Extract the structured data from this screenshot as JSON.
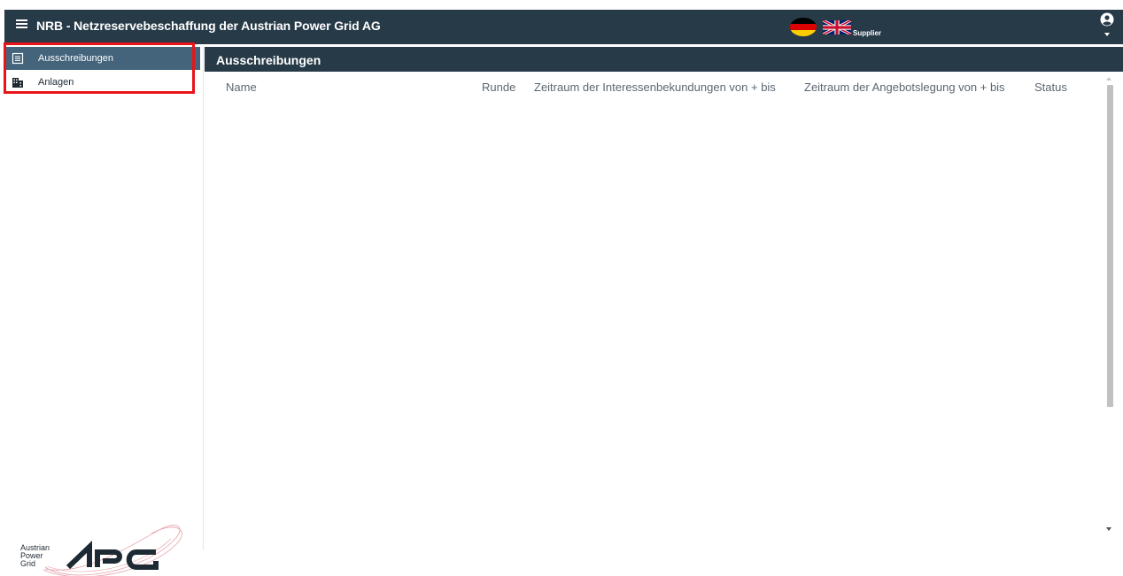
{
  "header": {
    "title": "NRB - Netzreservebeschaffung der Austrian Power Grid AG",
    "role": "Supplier",
    "colors": {
      "bar": "#273a48"
    },
    "icons": [
      "menu-icon",
      "german-flag-icon",
      "uk-flag-icon",
      "user-account-icon",
      "chevron-down-icon"
    ]
  },
  "sidebar": {
    "items": [
      {
        "label": "Ausschreibungen",
        "icon": "list-icon",
        "active": true
      },
      {
        "label": "Anlagen",
        "icon": "building-icon",
        "active": false
      }
    ],
    "logo": {
      "text_lines": [
        "Austrian",
        "Power",
        "Grid"
      ],
      "mark": "APG"
    },
    "colors": {
      "active": "#44647b",
      "highlight": "#e8141a"
    }
  },
  "main": {
    "section_title": "Ausschreibungen",
    "columns": [
      "Name",
      "Runde",
      "Zeitraum der Interessenbekundungen von + bis",
      "Zeitraum der Angebotslegung von + bis",
      "Status"
    ],
    "rows": []
  }
}
